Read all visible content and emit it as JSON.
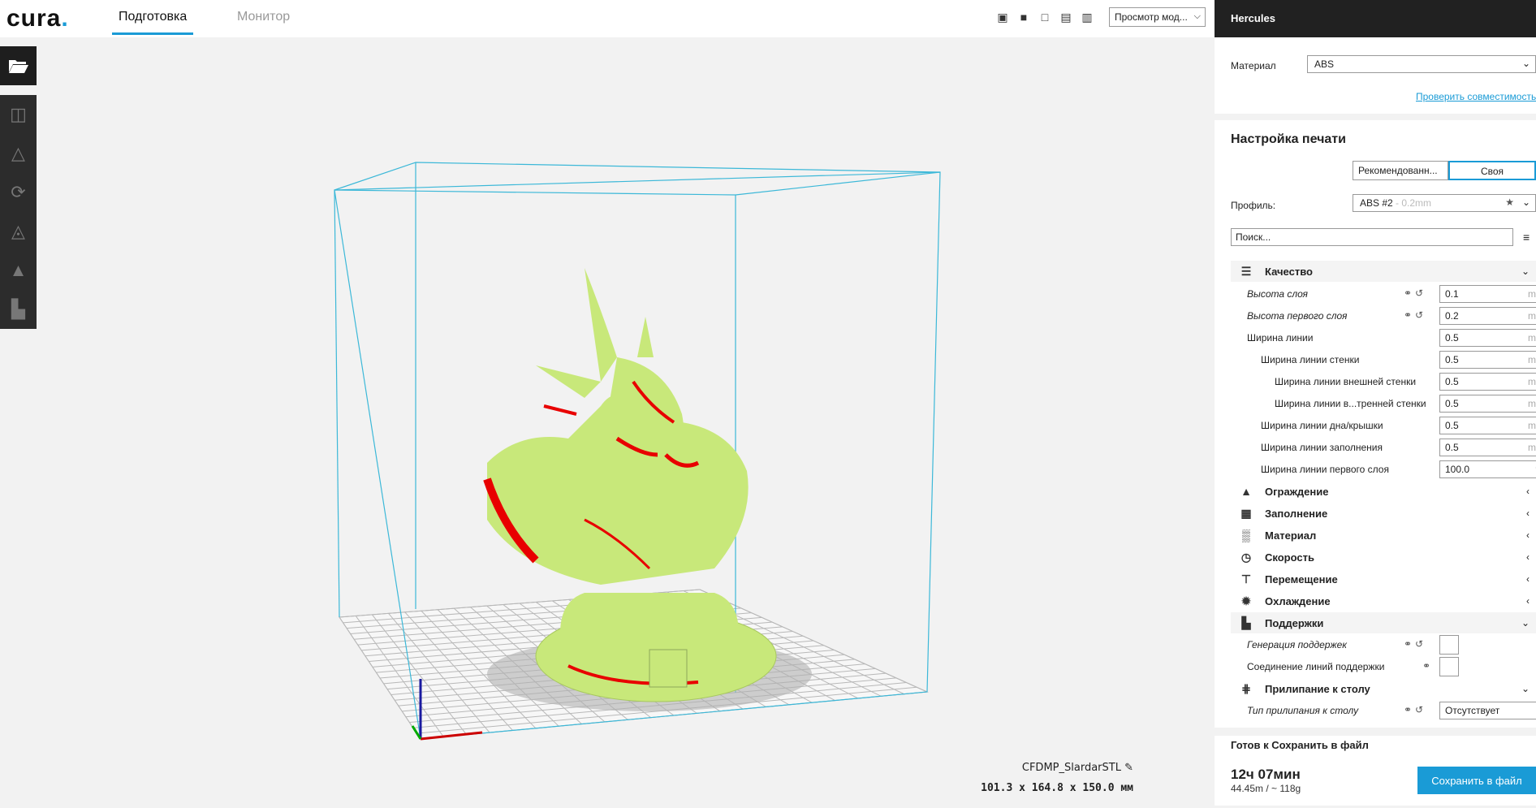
{
  "app": {
    "logo": "cura",
    "logo_dot": "."
  },
  "tabs": [
    {
      "label": "Подготовка"
    },
    {
      "label": "Монитор"
    }
  ],
  "view_mode": {
    "selected": "Просмотр мод..."
  },
  "model": {
    "name": "CFDMP_SlardarSTL",
    "dimensions": "101.3 x 164.8 x 150.0 мм"
  },
  "printer": {
    "name": "Hercules"
  },
  "material": {
    "label": "Материал",
    "value": "ABS",
    "compat_link": "Проверить совместимость"
  },
  "print_setup": {
    "title": "Настройка печати",
    "mode_recommended": "Рекомендованн...",
    "mode_custom": "Своя",
    "profile_label": "Профиль:",
    "profile_value": "ABS #2",
    "profile_suffix": " - 0.2mm",
    "search_placeholder": "Поиск..."
  },
  "categories": {
    "quality": "Качество",
    "shell": "Ограждение",
    "infill": "Заполнение",
    "material": "Материал",
    "speed": "Скорость",
    "travel": "Перемещение",
    "cooling": "Охлаждение",
    "support": "Поддержки",
    "adhesion": "Прилипание к столу"
  },
  "quality_settings": [
    {
      "name": "Высота слоя",
      "value": "0.1",
      "unit": "mm"
    },
    {
      "name": "Высота первого слоя",
      "value": "0.2",
      "unit": "mm"
    },
    {
      "name": "Ширина линии",
      "value": "0.5",
      "unit": "mm"
    },
    {
      "name": "Ширина линии стенки",
      "value": "0.5",
      "unit": "mm"
    },
    {
      "name": "Ширина линии внешней стенки",
      "value": "0.5",
      "unit": "mm"
    },
    {
      "name": "Ширина линии в...тренней стенки",
      "value": "0.5",
      "unit": "mm"
    },
    {
      "name": "Ширина линии дна/крышки",
      "value": "0.5",
      "unit": "mm"
    },
    {
      "name": "Ширина линии заполнения",
      "value": "0.5",
      "unit": "mm"
    },
    {
      "name": "Ширина линии первого слоя",
      "value": "100.0",
      "unit": "%"
    }
  ],
  "support_settings": [
    {
      "name": "Генерация поддержек"
    },
    {
      "name": "Соединение линий поддержки"
    }
  ],
  "adhesion_settings": [
    {
      "name": "Тип прилипания к столу",
      "value": "Отсутствует"
    }
  ],
  "status": {
    "ready": "Готов к Сохранить в файл",
    "time": "12ч 07мин",
    "material_usage": "44.45m / ~ 118g",
    "save_button": "Сохранить в файл"
  },
  "colors": {
    "accent": "#1a9bd6",
    "model": "#c8e87a",
    "overhang": "#e80000",
    "dark": "#212121"
  }
}
